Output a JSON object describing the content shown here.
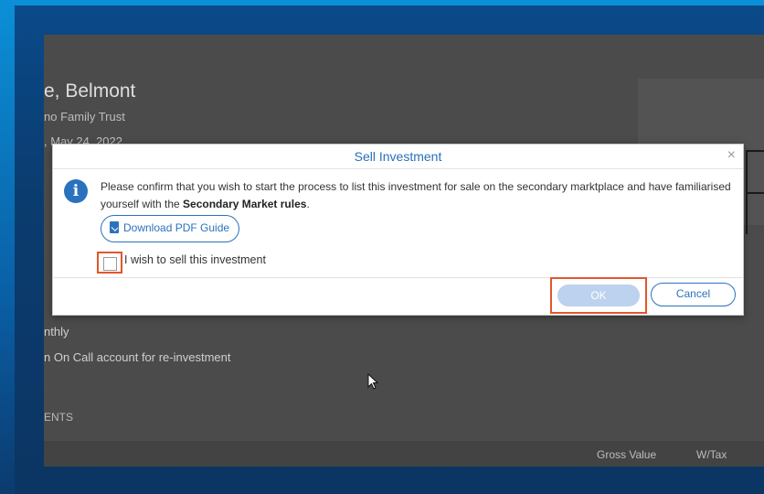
{
  "background": {
    "heading": "e, Belmont",
    "subheading": "no Family Trust",
    "date": ", May 24, 2022",
    "frequency": "nthly",
    "reinvest": "n On Call account for re-investment",
    "section": "ENTS",
    "col_gross_value": "Gross Value",
    "col_wtax": "W/Tax"
  },
  "dialog": {
    "title": "Sell Investment",
    "close_glyph": "×",
    "info_glyph": "i",
    "message_part1": "Please confirm that you wish to start the process to list this investment for sale on the secondary marktplace and have familiarised yourself with the ",
    "message_bold": "Secondary Market rules",
    "message_end": ".",
    "pdf_button": "Download PDF Guide",
    "checkbox_label": "I wish to sell this investment",
    "checkbox_checked": false,
    "ok_button": "OK",
    "cancel_button": "Cancel"
  },
  "colors": {
    "accent": "#2b72be",
    "highlight": "#e0572d",
    "ok_disabled": "#bcd2ee",
    "overlay": "#4b4b4b"
  }
}
